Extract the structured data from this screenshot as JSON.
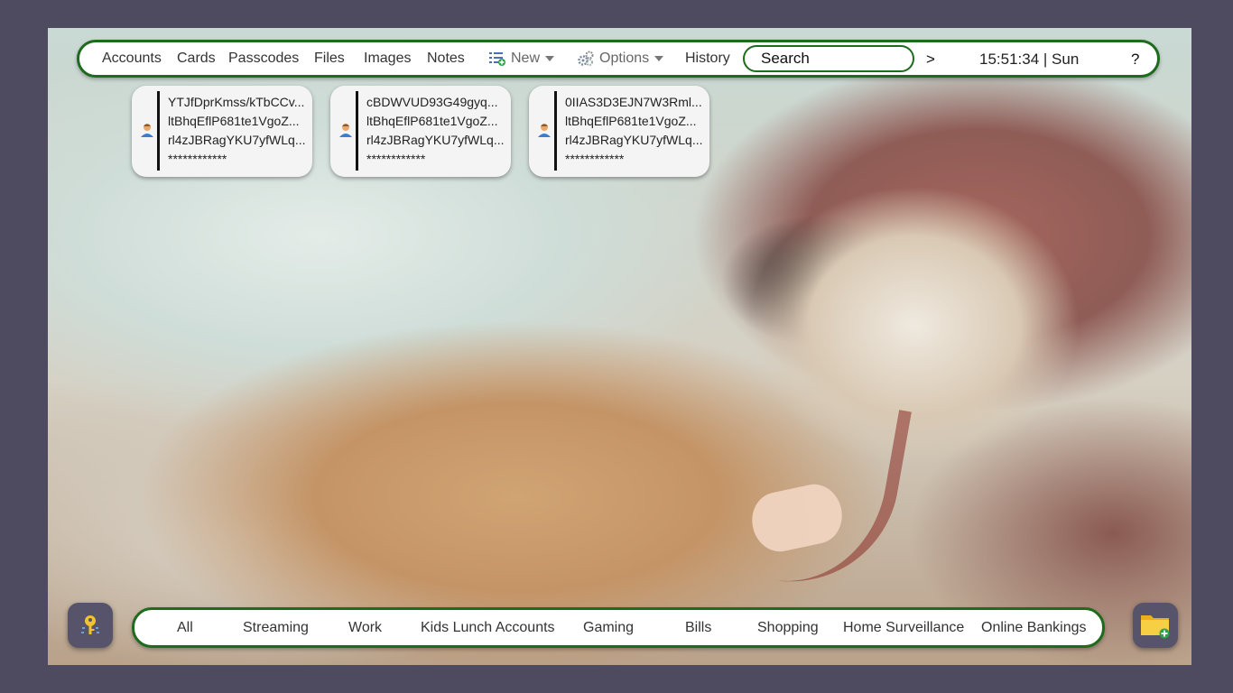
{
  "nav": {
    "accounts": "Accounts",
    "cards": "Cards",
    "passcodes": "Passcodes",
    "files": "Files",
    "images": "Images",
    "notes": "Notes",
    "new": "New",
    "options": "Options",
    "history": "History",
    "search_placeholder": "Search",
    "go": ">",
    "clock": "15:51:34 | Sun",
    "help": "?"
  },
  "cards": [
    {
      "line1": "YTJfDprKmss/kTbCCv...",
      "line2": "ltBhqEflP681te1VgoZ...",
      "line3": "rl4zJBRagYKU7yfWLq...",
      "password": "************"
    },
    {
      "line1": "cBDWVUD93G49gyq...",
      "line2": "ltBhqEflP681te1VgoZ...",
      "line3": "rl4zJBRagYKU7yfWLq...",
      "password": "************"
    },
    {
      "line1": "0IIAS3D3EJN7W3Rml...",
      "line2": "ltBhqEflP681te1VgoZ...",
      "line3": "rl4zJBRagYKU7yfWLq...",
      "password": "************"
    }
  ],
  "categories": [
    "All",
    "Streaming",
    "Work",
    "Kids Lunch Accounts",
    "Gaming",
    "Bills",
    "Shopping",
    "Home Surveillance",
    "Online Bankings"
  ],
  "icons": {
    "new": "list-add-icon",
    "options": "gears-icon",
    "card_avatar": "user-avatar-icon",
    "left_button": "key-icon",
    "right_button": "folder-add-icon"
  },
  "colors": {
    "accent": "#1e6b1e",
    "page_background": "#4e4a5f",
    "button_background": "#56536a"
  }
}
